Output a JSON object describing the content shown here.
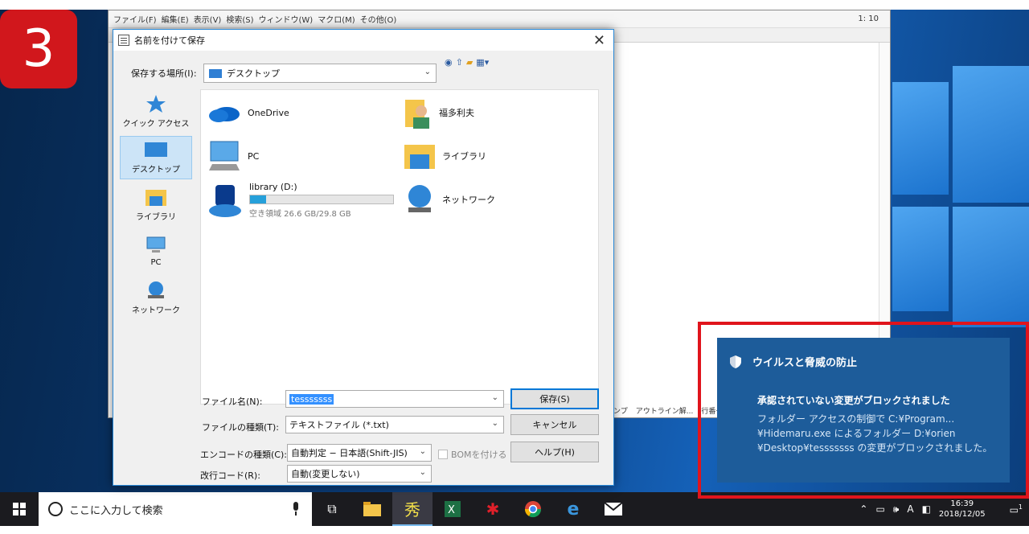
{
  "step": {
    "number": "3"
  },
  "editor": {
    "menu": [
      "ファイル(F)",
      "編集(E)",
      "表示(V)",
      "検索(S)",
      "ウィンドウ(W)",
      "マクロ(M)",
      "その他(O)"
    ],
    "cursor_pos": "1: 10",
    "status_items": [
      "ンプ",
      "アウトライン解...",
      "行番号"
    ]
  },
  "dialog": {
    "title": "名前を付けて保存",
    "location_label": "保存する場所(I):",
    "location_value": "デスクトップ",
    "sidebar": [
      {
        "label": "クイック アクセス",
        "icon": "star-icon"
      },
      {
        "label": "デスクトップ",
        "icon": "desktop-icon",
        "active": true
      },
      {
        "label": "ライブラリ",
        "icon": "library-icon"
      },
      {
        "label": "PC",
        "icon": "pc-icon"
      },
      {
        "label": "ネットワーク",
        "icon": "network-icon"
      }
    ],
    "items": {
      "onedrive": "OneDrive",
      "user": "福多利夫",
      "pc": "PC",
      "library": "ライブラリ",
      "drive_name": "library (D:)",
      "drive_free": "空き領域 26.6 GB/29.8 GB",
      "drive_used_fraction": 0.11,
      "network": "ネットワーク"
    },
    "form": {
      "filename_label": "ファイル名(N):",
      "filename_value": "tesssssss",
      "filetype_label": "ファイルの種類(T):",
      "filetype_value": "テキストファイル (*.txt)",
      "encoding_label": "エンコードの種類(C):",
      "encoding_value": "自動判定 − 日本語(Shift-JIS)",
      "bom_label": "BOMを付ける",
      "newline_label": "改行コード(R):",
      "newline_value": "自動(変更しない)"
    },
    "buttons": {
      "save": "保存(S)",
      "cancel": "キャンセル",
      "help": "ヘルプ(H)"
    }
  },
  "toast": {
    "title": "ウイルスと脅威の防止",
    "subtitle": "承認されていない変更がブロックされました",
    "body": "フォルダー アクセスの制御で C:¥Program... ¥Hidemaru.exe によるフォルダー D:¥orien ¥Desktop¥tesssssss の変更がブロックされました。"
  },
  "taskbar": {
    "search_placeholder": "ここに入力して検索",
    "time": "16:39",
    "date": "2018/12/05",
    "ime": "A",
    "notification_count": "1"
  },
  "colors": {
    "accent": "#0078d7",
    "badge": "#d1171c",
    "toast_bg": "#1d5c9a",
    "highlight_frame": "#e0141c"
  }
}
